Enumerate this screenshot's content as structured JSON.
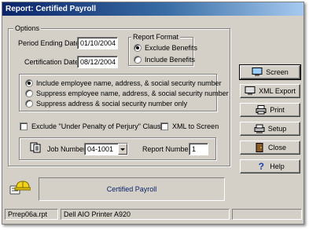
{
  "window": {
    "title": "Report: Certified Payroll"
  },
  "options": {
    "legend": "Options",
    "period_ending_label": "Period Ending Date:",
    "period_ending_value": "01/10/2004",
    "certification_label": "Certification Date:",
    "certification_value": "08/12/2004"
  },
  "report_format": {
    "legend": "Report Format",
    "items": [
      {
        "label": "Exclude Benefits",
        "selected": true
      },
      {
        "label": "Include Benefits",
        "selected": false
      }
    ]
  },
  "employee_info": {
    "items": [
      {
        "label": "Include employee name, address, & social security number",
        "selected": true
      },
      {
        "label": "Suppress employee name, address, & social security number",
        "selected": false
      },
      {
        "label": "Suppress address & social security number only",
        "selected": false
      }
    ]
  },
  "checkboxes": {
    "perjury_label": "Exclude \"Under Penalty of Perjury\" Clause",
    "xml_screen_label": "XML to Screen"
  },
  "job": {
    "job_number_label": "Job Number:",
    "job_number_value": "04-1001",
    "report_number_label": "Report Number:",
    "report_number_value": "1"
  },
  "report_name": "Certified Payroll",
  "buttons": {
    "screen": "Screen",
    "xml_export": "XML Export",
    "print": "Print",
    "setup": "Setup",
    "close": "Close",
    "help": "Help"
  },
  "status": {
    "file": "Prrep06a.rpt",
    "printer": "Dell AIO Printer A920"
  },
  "colors": {
    "title_start": "#0a246a",
    "title_end": "#a6caf0",
    "report_name_text": "#0a246a",
    "face": "#d4d0c8"
  }
}
